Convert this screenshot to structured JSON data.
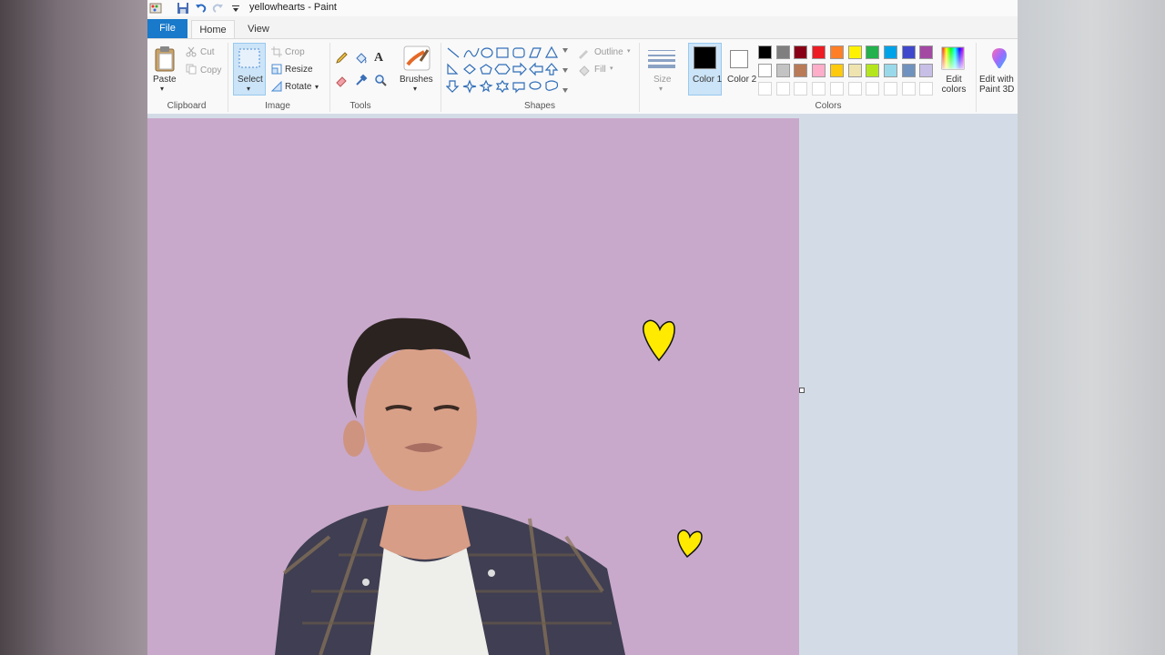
{
  "window": {
    "title": "yellowhearts - Paint"
  },
  "tabs": {
    "file": "File",
    "home": "Home",
    "view": "View"
  },
  "clipboard": {
    "paste": "Paste",
    "cut": "Cut",
    "copy": "Copy",
    "group_label": "Clipboard"
  },
  "image": {
    "select": "Select",
    "crop": "Crop",
    "resize": "Resize",
    "rotate": "Rotate",
    "group_label": "Image"
  },
  "tools": {
    "group_label": "Tools",
    "brushes": "Brushes"
  },
  "shapes": {
    "outline": "Outline",
    "fill": "Fill",
    "group_label": "Shapes",
    "size": "Size"
  },
  "colors": {
    "color1": "Color 1",
    "color1_value": "#000000",
    "color2": "Color 2",
    "color2_value": "#ffffff",
    "edit_colors": "Edit colors",
    "group_label": "Colors",
    "palette_row1": [
      "#000000",
      "#7f7f7f",
      "#880015",
      "#ed1c24",
      "#ff7f27",
      "#fff200",
      "#22b14c",
      "#00a2e8",
      "#3f48cc",
      "#a349a4"
    ],
    "palette_row2": [
      "#ffffff",
      "#c3c3c3",
      "#b97a57",
      "#ffaec9",
      "#ffc90e",
      "#efe4b0",
      "#b5e61d",
      "#99d9ea",
      "#7092be",
      "#c8bfe7"
    ]
  },
  "paint3d": {
    "label": "Edit with Paint 3D"
  },
  "canvas": {
    "background": "#c8a9cb",
    "heart_color": "#ffea00"
  }
}
